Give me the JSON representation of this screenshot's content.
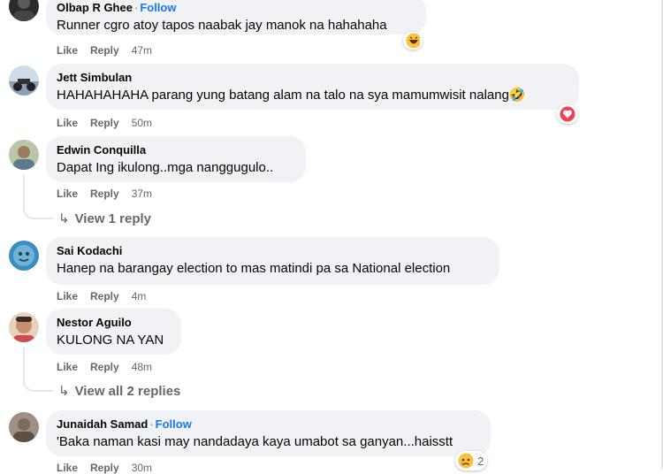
{
  "comments": [
    {
      "name": "Olbap R Ghee",
      "follow": "Follow",
      "text": "Runner cgro atoy tapos naabak jay manok na hahahaha",
      "like": "Like",
      "reply": "Reply",
      "time": "47m",
      "reaction": "laugh-emoji"
    },
    {
      "name": "Jett Simbulan",
      "text": "HAHAHAHAHA parang yung batang alam na talo na sya mamumwisit nalang🤣",
      "like": "Like",
      "reply": "Reply",
      "time": "50m",
      "reaction": "heart-emoji"
    },
    {
      "name": "Edwin Conquilla",
      "text": "Dapat Ing ikulong..mga nanggugulo..",
      "like": "Like",
      "reply": "Reply",
      "time": "37m",
      "view_replies": "View 1 reply"
    },
    {
      "name": "Sai Kodachi",
      "text": "Hanep na barangay election to mas matindi pa sa National election",
      "like": "Like",
      "reply": "Reply",
      "time": "4m"
    },
    {
      "name": "Nestor Aguilo",
      "text": "KULONG NA YAN",
      "like": "Like",
      "reply": "Reply",
      "time": "48m",
      "view_replies": "View all 2 replies"
    },
    {
      "name": "Junaidah Samad",
      "follow": "Follow",
      "text": "'Baka naman kasi may nandadaya kaya umabot sa ganyan...haisstt",
      "like": "Like",
      "reply": "Reply",
      "time": "30m",
      "reaction": "sad-emoji",
      "reaction_count": "2"
    }
  ],
  "colors": {
    "bubble": "#f0f2f5",
    "meta": "#65676b",
    "follow": "#1877f2"
  }
}
